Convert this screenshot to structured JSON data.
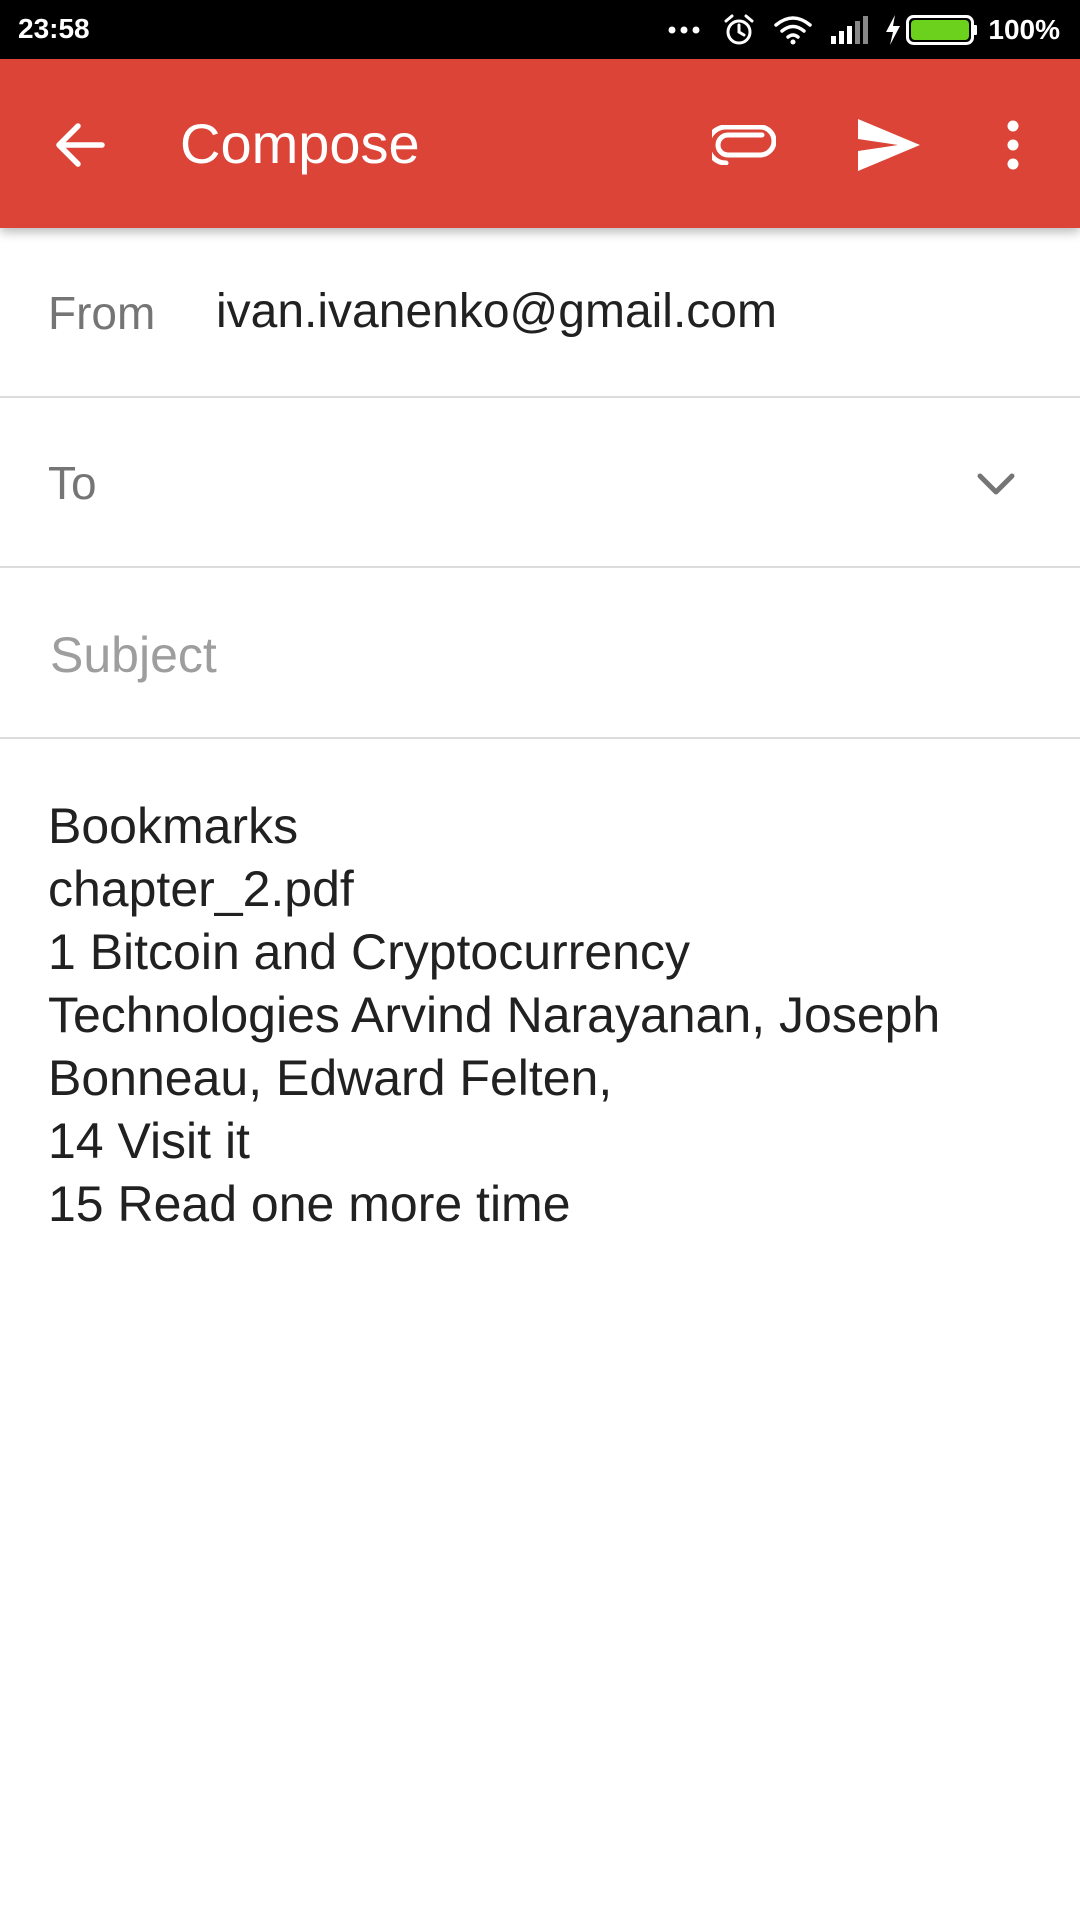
{
  "status_bar": {
    "time": "23:58",
    "battery_text": "100%",
    "battery_color": "#6bd11c",
    "icons": [
      "more-dots-icon",
      "alarm-icon",
      "wifi-icon",
      "signal-icon",
      "charging-bolt-icon",
      "battery-icon"
    ]
  },
  "app_bar": {
    "title": "Compose",
    "background_color": "#db4437",
    "icons": [
      "back-arrow-icon",
      "attachment-icon",
      "send-icon",
      "more-vert-icon"
    ]
  },
  "from": {
    "label": "From",
    "value": "ivan.ivanenko@gmail.com"
  },
  "to": {
    "label": "To",
    "value": "",
    "icon": "chevron-down-icon"
  },
  "subject": {
    "placeholder": "Subject",
    "value": ""
  },
  "body": {
    "lines": [
      "Bookmarks",
      "chapter_2.pdf",
      "1 Bitcoin and Cryptocurrency",
      "Technologies Arvind Narayanan, Joseph",
      "Bonneau, Edward Felten,",
      "14 Visit it",
      "15 Read one more time"
    ]
  }
}
